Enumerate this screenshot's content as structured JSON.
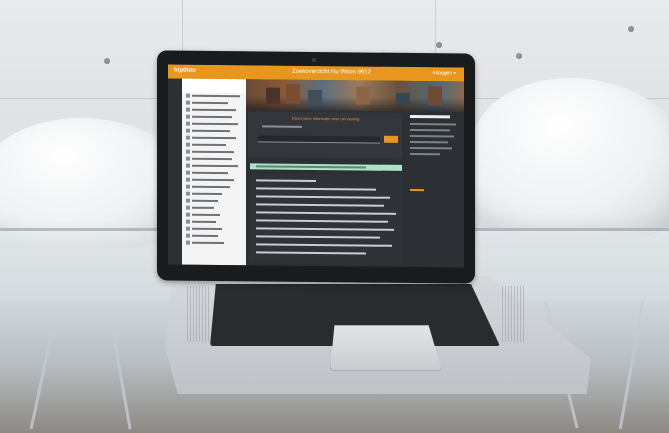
{
  "screen": {
    "logo_text": "hipthter",
    "site_title": "Zoekoverzicht Nu Woon 9912",
    "top_link": "Inloggen ▾",
    "main_card_title": "Rond meer informatie over uw woning",
    "input_placeholder": "",
    "button_label": ""
  },
  "colors": {
    "accent": "#e8961e",
    "screen_bg": "#2c2f33",
    "notice": "#aee0c8"
  },
  "icons": [
    "camera-icon"
  ]
}
